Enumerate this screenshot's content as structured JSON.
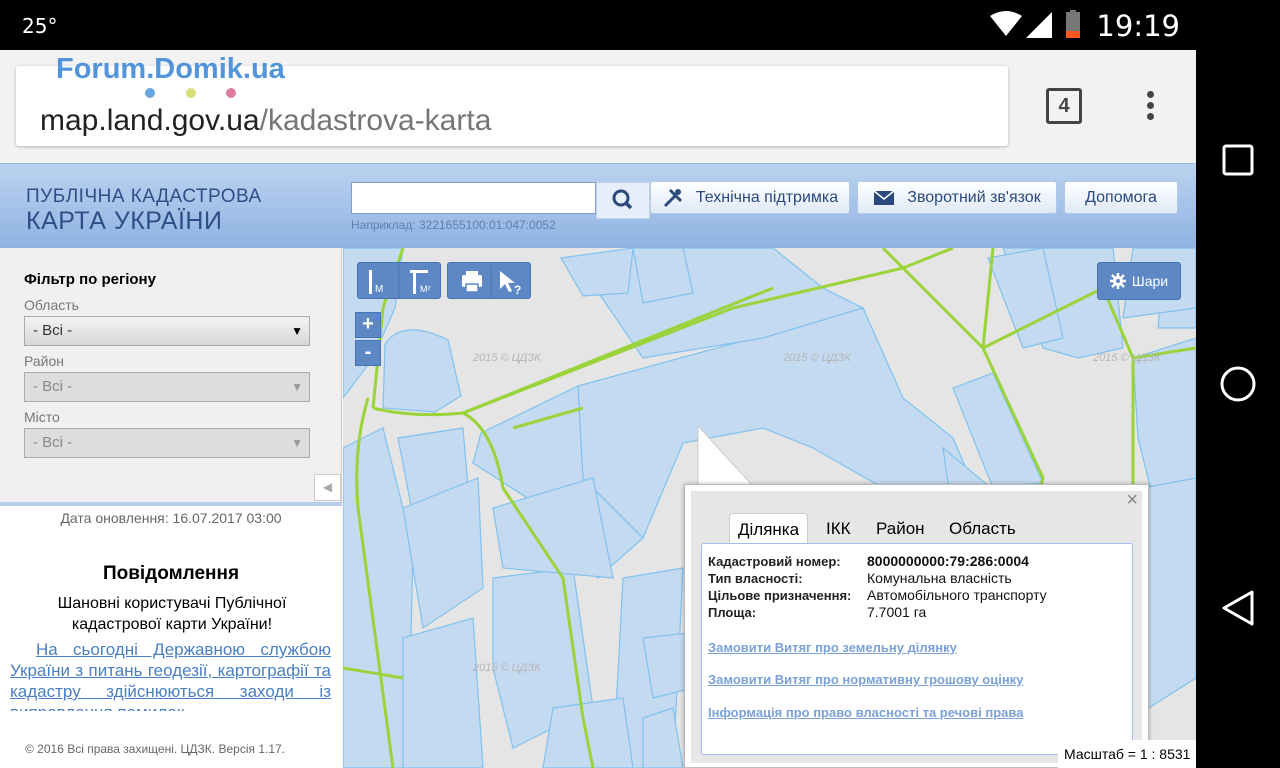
{
  "statusbar": {
    "temperature": "25°",
    "time": "19:19"
  },
  "browser": {
    "url_domain": "map.land.gov.ua",
    "url_path": "/kadastrova-karta",
    "tab_count": "4",
    "watermark": "Forum.Domik.ua"
  },
  "header": {
    "logo_line1": "ПУБЛІЧНА КАДАСТРОВА",
    "logo_line2": "КАРТА УКРАЇНИ",
    "search_value": "",
    "search_hint": "Наприклад: 3221655100:01:047:0052",
    "buttons": [
      {
        "label": "Технічна підтримка",
        "icon": "tools-icon"
      },
      {
        "label": "Зворотний зв'язок",
        "icon": "envelope-icon"
      },
      {
        "label": "Допомога"
      }
    ]
  },
  "sidebar": {
    "filter_title": "Фільтр по регіону",
    "filters": [
      {
        "label": "Область",
        "value": "- Всі -",
        "enabled": true
      },
      {
        "label": "Район",
        "value": "- Всі -",
        "enabled": false
      },
      {
        "label": "Місто",
        "value": "- Всі -",
        "enabled": false
      }
    ],
    "updated": "Дата оновлення: 16.07.2017 03:00",
    "notice_title": "Повідомлення",
    "notice_body": "Шановні користувачі Публічної кадастрової карти України!",
    "notice_link": "На сьогодні Державною службою України з питань геодезії, картографії та кадастру здійснюються заходи із виправлення помилок",
    "copyright": "© 2016 Всі права захищені. ЦДЗК. Версія 1.17."
  },
  "map": {
    "layers_label": "Шари",
    "tile_watermark": "2015 © ЦДЗК",
    "tool_icons": [
      "ruler-m-icon",
      "area-m2-icon",
      "print-icon",
      "identify-cursor-icon"
    ],
    "zoom_in": "+",
    "zoom_out": "-",
    "scale": "Масштаб = 1 : 8531",
    "colors": {
      "parcel_fill": "#c4daf0",
      "parcel_stroke": "#7fc2ef",
      "boundary": "#9ad33a"
    }
  },
  "popup": {
    "tabs": [
      "Ділянка",
      "ІКК",
      "Район",
      "Область"
    ],
    "active_tab": "Ділянка",
    "fields": [
      {
        "label": "Кадастровий номер:",
        "value": "8000000000:79:286:0004",
        "bold": true
      },
      {
        "label": "Тип власності:",
        "value": "Комунальна власність"
      },
      {
        "label": "Цільове призначення:",
        "value": "Автомобільного транспорту"
      },
      {
        "label": "Площа:",
        "value": "7.7001 га"
      }
    ],
    "links": [
      "Замовити Витяг про земельну ділянку",
      "Замовити Витяг про нормативну грошову оцінку",
      "Інформація про право власності та речові права"
    ]
  }
}
